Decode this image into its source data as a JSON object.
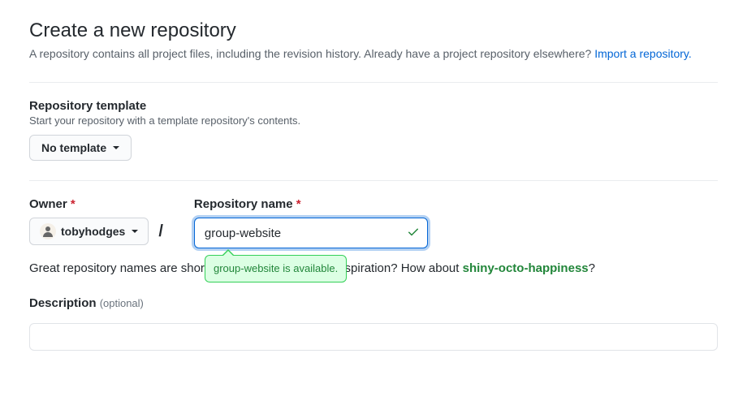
{
  "header": {
    "title": "Create a new repository",
    "subtitle_before": "A repository contains all project files, including the revision history. Already have a project repository elsewhere? ",
    "subtitle_link": "Import a repository."
  },
  "template": {
    "label": "Repository template",
    "hint": "Start your repository with a template repository's contents.",
    "selected": "No template"
  },
  "owner": {
    "label": "Owner",
    "required_marker": "*",
    "username": "tobyhodges"
  },
  "repo": {
    "label": "Repository name",
    "required_marker": "*",
    "value": "group-website",
    "availability_message": "group-website is available."
  },
  "hint": {
    "text_before": "Great repository names are short and memorable. Need inspiration? How about ",
    "suggestion": "shiny-octo-happiness",
    "text_after": "?"
  },
  "description": {
    "label": "Description",
    "optional": "(optional)"
  }
}
